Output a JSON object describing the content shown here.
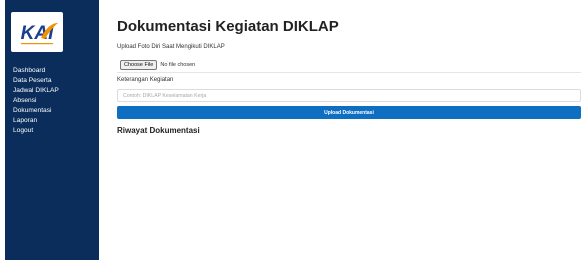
{
  "sidebar": {
    "logo_text": "KAI",
    "items": [
      {
        "label": "Dashboard"
      },
      {
        "label": "Data Peserta"
      },
      {
        "label": "Jadwal DIKLAP"
      },
      {
        "label": "Absensi"
      },
      {
        "label": "Dokumentasi"
      },
      {
        "label": "Laporan"
      },
      {
        "label": "Logout"
      }
    ]
  },
  "main": {
    "title": "Dokumentasi Kegiatan DIKLAP",
    "upload_label": "Upload Foto Diri Saat Mengikuti DIKLAP",
    "file_input": {
      "button_label": "Choose File",
      "status": "No file chosen"
    },
    "keterangan": {
      "label": "Keterangan Kegiatan",
      "placeholder": "Contoh: DIKLAP Keselamatan Kerja",
      "value": ""
    },
    "upload_button": "Upload Dokumentasi",
    "history_title": "Riwayat Dokumentasi"
  },
  "colors": {
    "sidebar_bg": "#0a2d5c",
    "primary_button": "#0d6ec2",
    "logo_blue": "#1b3f8f",
    "logo_orange": "#f39200"
  }
}
